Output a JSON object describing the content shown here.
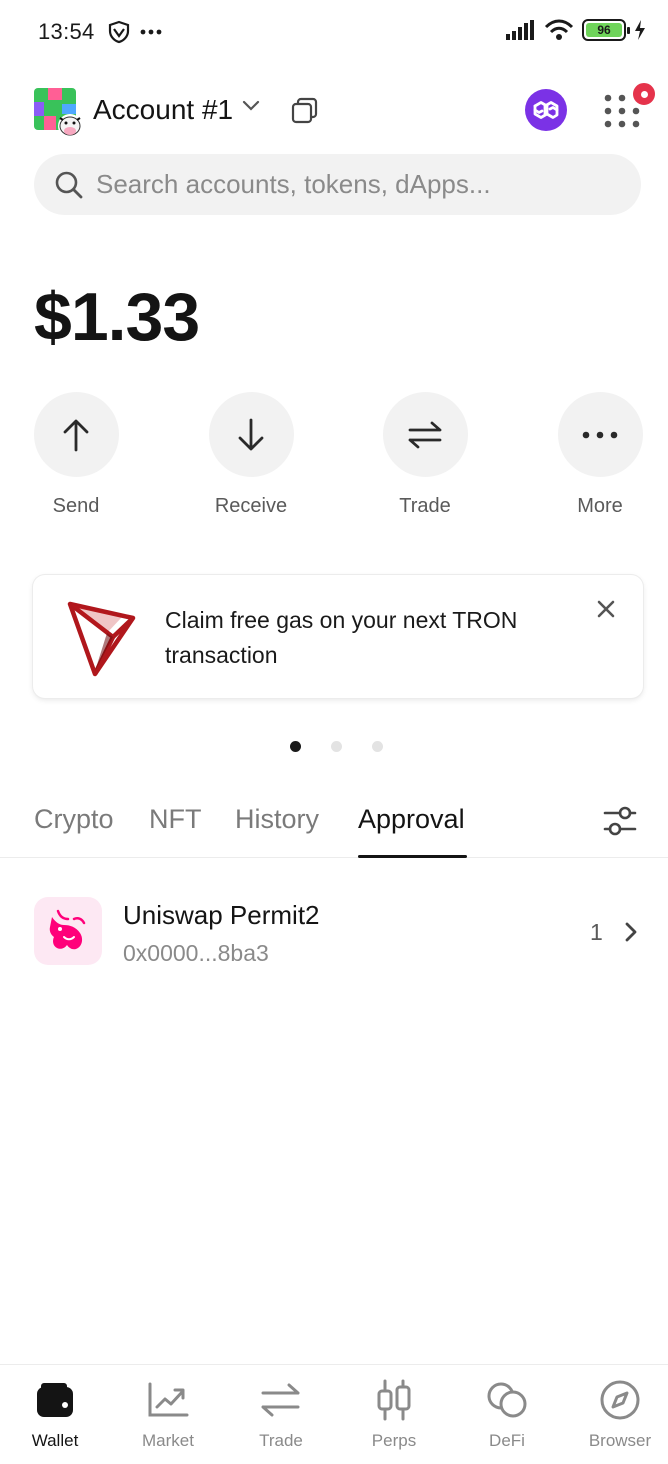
{
  "status_bar": {
    "time": "13:54",
    "battery": "96"
  },
  "header": {
    "account_name": "Account #1"
  },
  "search": {
    "placeholder": "Search accounts, tokens, dApps..."
  },
  "balance": {
    "amount": "$1.33"
  },
  "actions": [
    {
      "label": "Send",
      "icon": "arrow-up-icon"
    },
    {
      "label": "Receive",
      "icon": "arrow-down-icon"
    },
    {
      "label": "Trade",
      "icon": "swap-icon"
    },
    {
      "label": "More",
      "icon": "more-icon"
    }
  ],
  "banner": {
    "text": "Claim free gas on your next TRON transaction",
    "icon": "tron-logo",
    "carousel_pages": 3,
    "carousel_active": 1
  },
  "tabs": [
    {
      "label": "Crypto",
      "active": false
    },
    {
      "label": "NFT",
      "active": false
    },
    {
      "label": "History",
      "active": false
    },
    {
      "label": "Approval",
      "active": true
    }
  ],
  "approvals": [
    {
      "name": "Uniswap Permit2",
      "address": "0x0000...8ba3",
      "count": "1",
      "icon": "uniswap-icon"
    }
  ],
  "bottom_nav": [
    {
      "label": "Wallet",
      "icon": "wallet-icon",
      "active": true
    },
    {
      "label": "Market",
      "icon": "market-chart-icon",
      "active": false
    },
    {
      "label": "Trade",
      "icon": "trade-icon",
      "active": false
    },
    {
      "label": "Perps",
      "icon": "candlestick-icon",
      "active": false
    },
    {
      "label": "DeFi",
      "icon": "defi-icon",
      "active": false
    },
    {
      "label": "Browser",
      "icon": "compass-icon",
      "active": false
    }
  ],
  "colors": {
    "accent_purple": "#7b32e6",
    "notification_red": "#e5334b",
    "tron_red": "#c4161c",
    "uniswap_pink": "#ff007a",
    "battery_green": "#6fd45a"
  }
}
